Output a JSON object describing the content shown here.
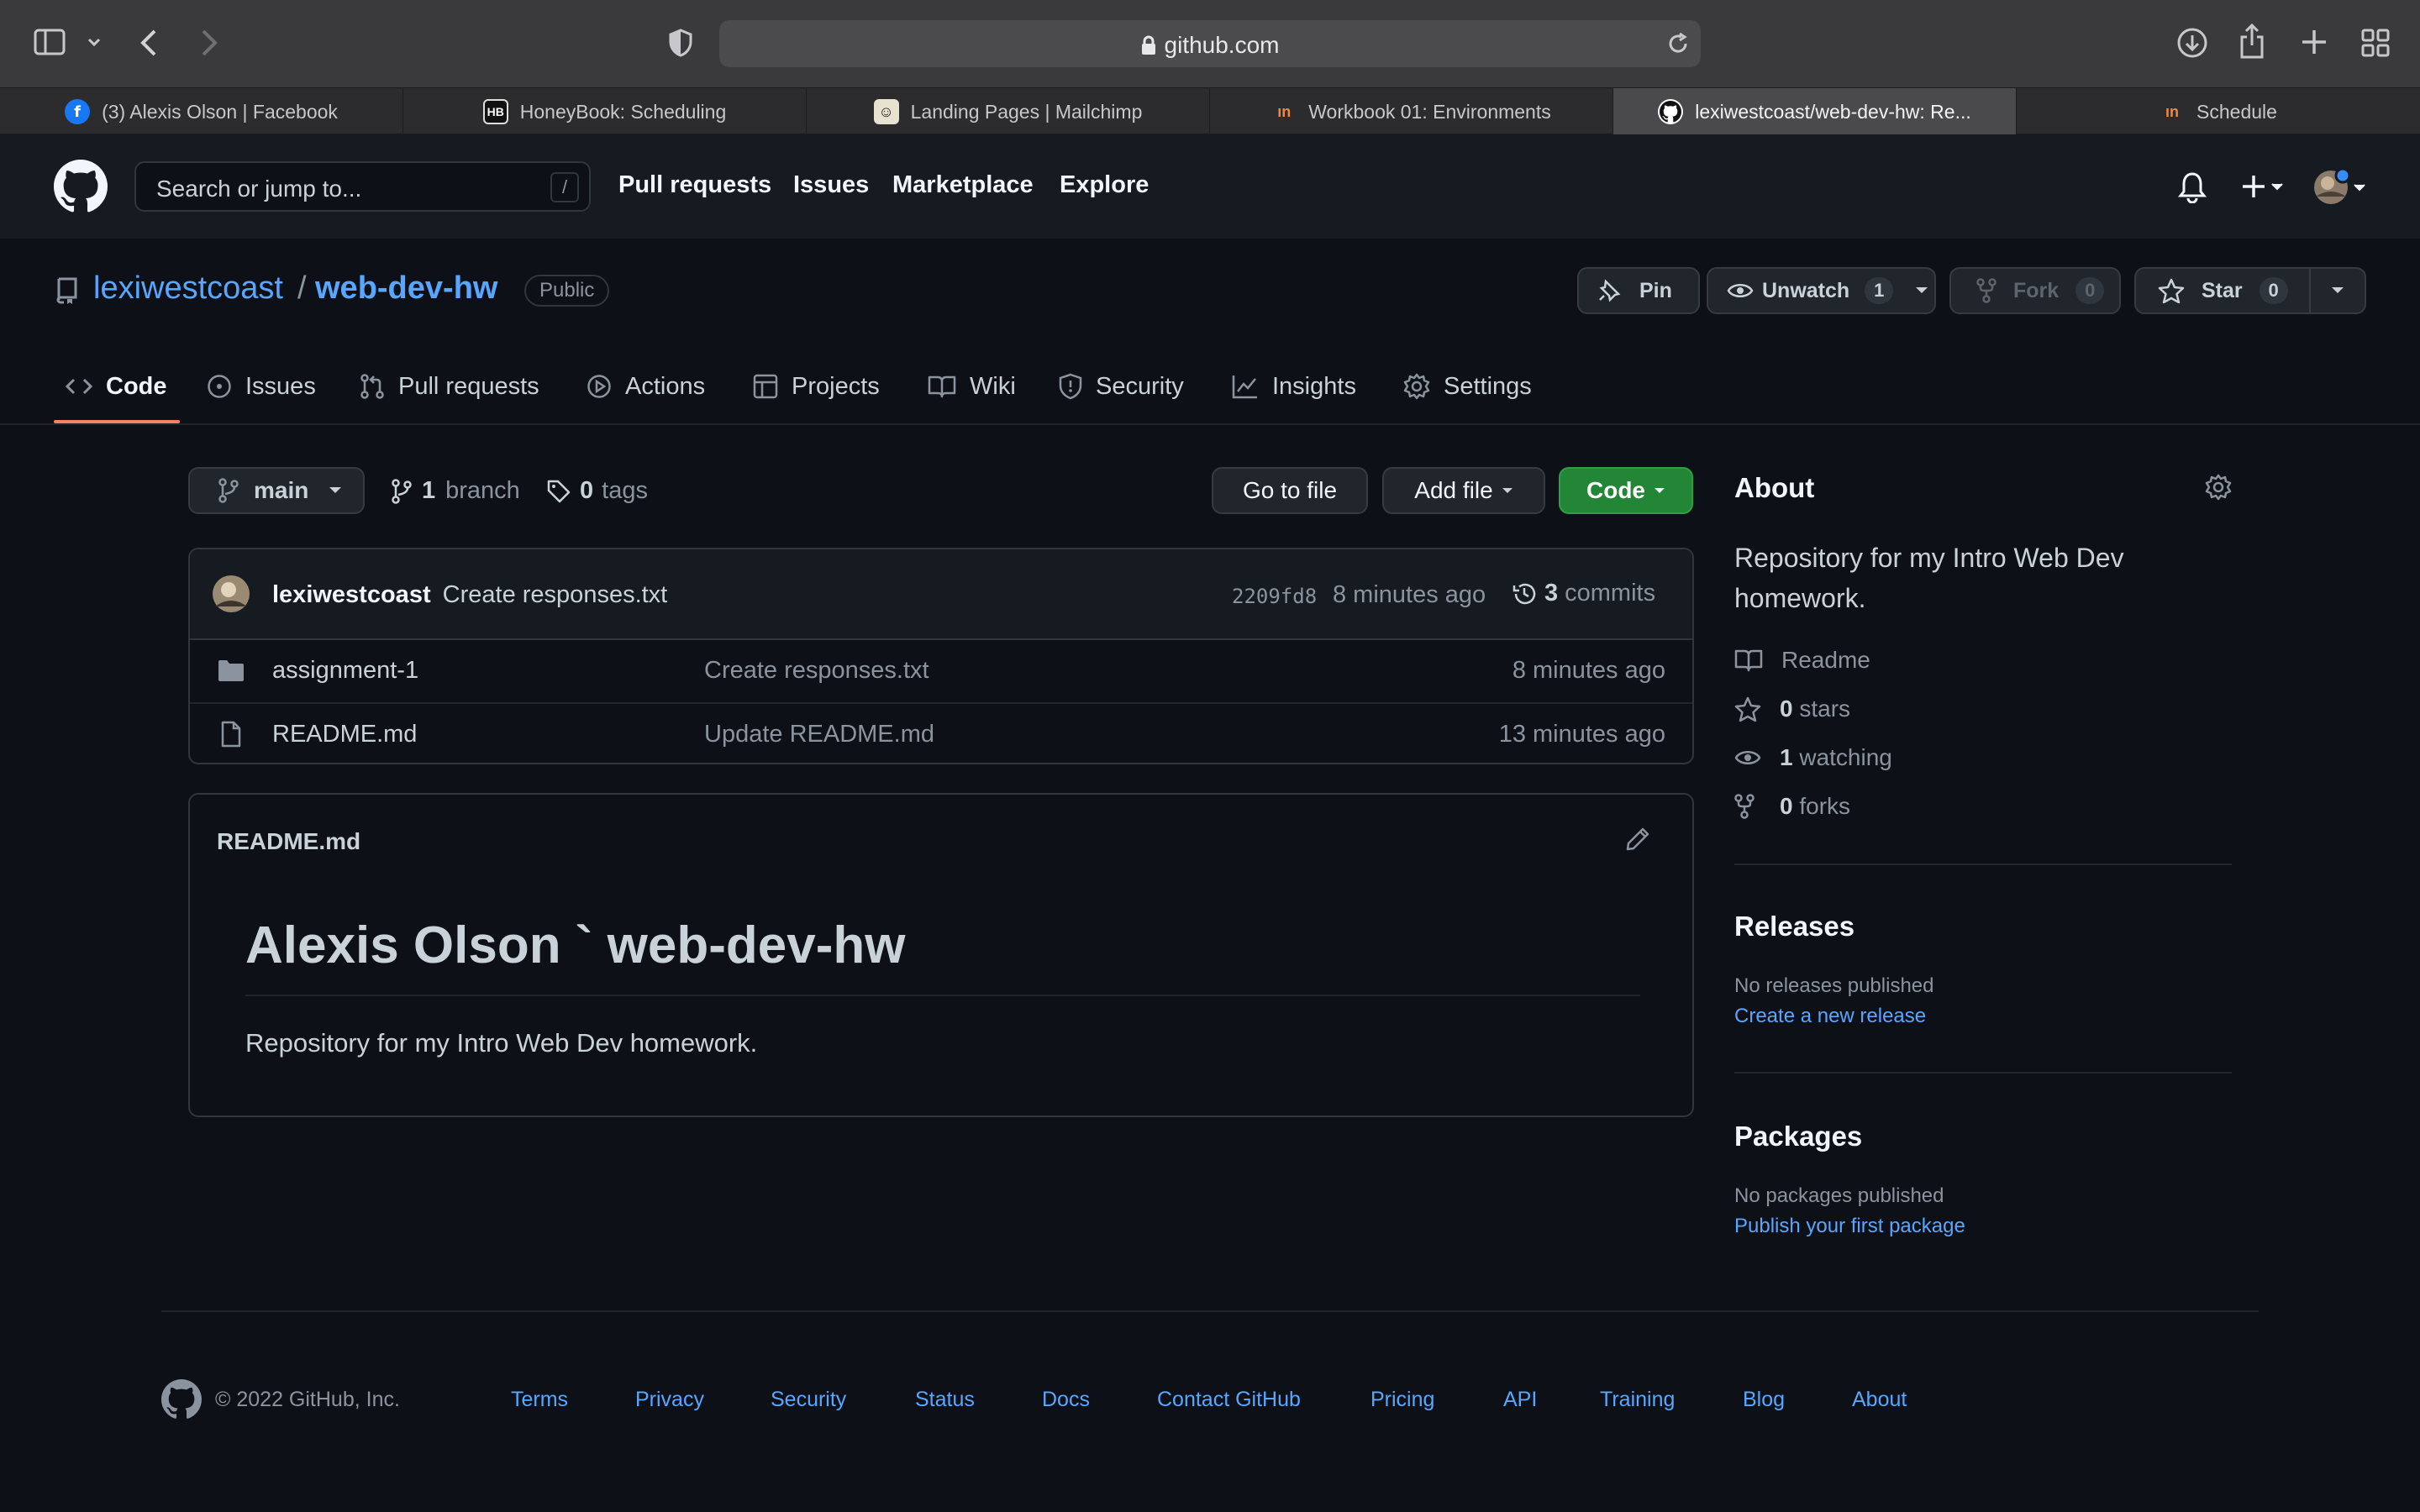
{
  "browser": {
    "url": "github.com",
    "tabs": [
      {
        "label": "(3) Alexis Olson | Facebook",
        "favicon": "facebook-icon"
      },
      {
        "label": "HoneyBook: Scheduling",
        "favicon": "honeybook-icon"
      },
      {
        "label": "Landing Pages | Mailchimp",
        "favicon": "mailchimp-icon"
      },
      {
        "label": "Workbook 01: Environments",
        "favicon": "workbook-icon"
      },
      {
        "label": "lexiwestcoast/web-dev-hw: Re...",
        "favicon": "github-icon"
      },
      {
        "label": "Schedule",
        "favicon": "workbook-icon"
      }
    ]
  },
  "gh": {
    "search_placeholder": "Search or jump to...",
    "search_shortcut": "/",
    "nav": [
      "Pull requests",
      "Issues",
      "Marketplace",
      "Explore"
    ]
  },
  "repo": {
    "owner": "lexiwestcoast",
    "separator": "/",
    "name": "web-dev-hw",
    "visibility": "Public",
    "pin_label": "Pin",
    "unwatch_label": "Unwatch",
    "watch_count": "1",
    "fork_label": "Fork",
    "fork_count": "0",
    "star_label": "Star",
    "star_count": "0",
    "tabs": [
      "Code",
      "Issues",
      "Pull requests",
      "Actions",
      "Projects",
      "Wiki",
      "Security",
      "Insights",
      "Settings"
    ]
  },
  "files": {
    "branch": "main",
    "branch_count": "1",
    "branch_label": "branch",
    "tag_count": "0",
    "tag_label": "tags",
    "go_to_file": "Go to file",
    "add_file": "Add file",
    "code": "Code",
    "latest_commit": {
      "author": "lexiwestcoast",
      "message": "Create responses.txt",
      "sha": "2209fd8",
      "time": "8 minutes ago",
      "commit_count": "3",
      "commit_label": "commits"
    },
    "rows": [
      {
        "name": "assignment-1",
        "type": "folder",
        "message": "Create responses.txt",
        "time": "8 minutes ago"
      },
      {
        "name": "README.md",
        "type": "file",
        "message": "Update README.md",
        "time": "13 minutes ago"
      }
    ]
  },
  "readme": {
    "filename": "README.md",
    "heading": "Alexis Olson ` web-dev-hw",
    "body": "Repository for my Intro Web Dev homework."
  },
  "about": {
    "title": "About",
    "description_line1": "Repository for my Intro Web Dev",
    "description_line2": "homework.",
    "readme": "Readme",
    "stars_count": "0",
    "stars_label": "stars",
    "watching_count": "1",
    "watching_label": "watching",
    "forks_count": "0",
    "forks_label": "forks",
    "releases_title": "Releases",
    "releases_none": "No releases published",
    "releases_link": "Create a new release",
    "packages_title": "Packages",
    "packages_none": "No packages published",
    "packages_link": "Publish your first package"
  },
  "footer": {
    "copyright": "© 2022 GitHub, Inc.",
    "links": [
      "Terms",
      "Privacy",
      "Security",
      "Status",
      "Docs",
      "Contact GitHub",
      "Pricing",
      "API",
      "Training",
      "Blog",
      "About"
    ]
  },
  "colors": {
    "bg": "#0d1117",
    "header": "#161b22",
    "link": "#58a6ff",
    "green_button": "#238636",
    "tab_underline": "#f78166"
  }
}
